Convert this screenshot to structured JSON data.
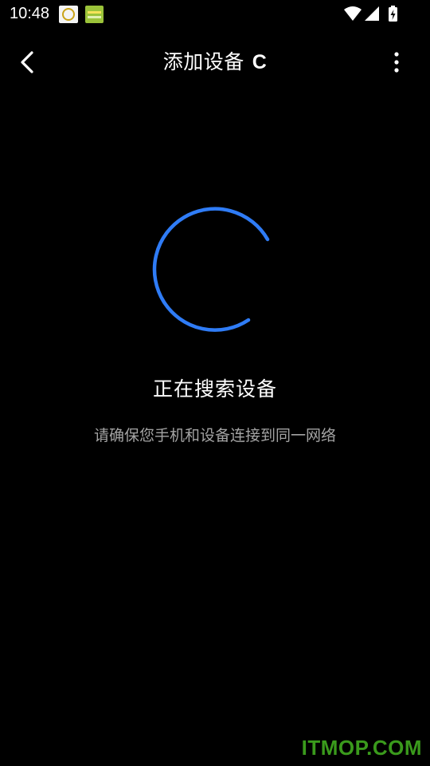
{
  "status_bar": {
    "time": "10:48",
    "icons": [
      "app-notification-icon",
      "app-notification-icon",
      "wifi-icon",
      "signal-icon",
      "battery-charging-icon"
    ]
  },
  "app_bar": {
    "title": "添加设备",
    "refresh_glyph": "C",
    "back_icon": "chevron-left-icon",
    "more_icon": "more-vertical-icon"
  },
  "search": {
    "heading": "正在搜索设备",
    "hint": "请确保您手机和设备连接到同一网络",
    "spinner_color": "#2f7cf6"
  },
  "watermark": {
    "text": "ITMOP.COM",
    "color": "#3a9a1c"
  }
}
